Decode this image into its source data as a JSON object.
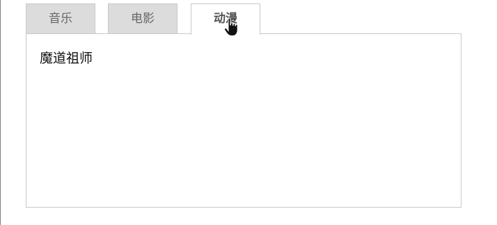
{
  "tabs": [
    {
      "label": "音乐",
      "active": false
    },
    {
      "label": "电影",
      "active": false
    },
    {
      "label": "动漫",
      "active": true
    }
  ],
  "panel": {
    "content": "魔道祖师"
  },
  "cursor": {
    "icon": "hand-pointer-icon"
  }
}
